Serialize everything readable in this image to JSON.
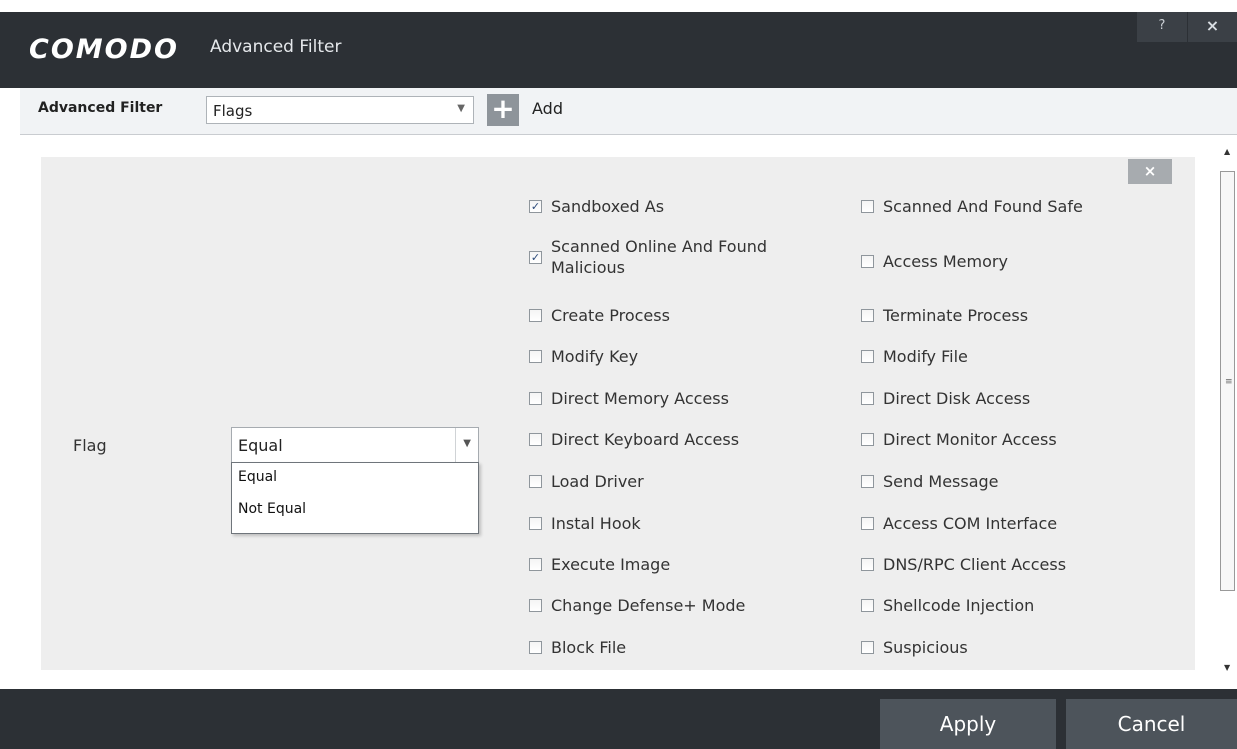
{
  "window": {
    "brand": "COMODO",
    "title": "Advanced Filter",
    "help_label": "?",
    "close_label": "×"
  },
  "toolbar": {
    "filter_label": "Advanced Filter",
    "filter_value": "Flags",
    "add_label": "Add"
  },
  "panel": {
    "remove_label": "×",
    "flag_label": "Flag",
    "condition_value": "Equal",
    "condition_options": [
      "Equal",
      "Not Equal"
    ],
    "flags_left": [
      {
        "label": "Sandboxed As",
        "checked": true
      },
      {
        "label": "Scanned Online And Found Malicious",
        "checked": true
      },
      {
        "label": "Create Process",
        "checked": false
      },
      {
        "label": "Modify Key",
        "checked": false
      },
      {
        "label": "Direct Memory Access",
        "checked": false
      },
      {
        "label": "Direct Keyboard Access",
        "checked": false
      },
      {
        "label": "Load Driver",
        "checked": false
      },
      {
        "label": "Instal Hook",
        "checked": false
      },
      {
        "label": "Execute Image",
        "checked": false
      },
      {
        "label": "Change Defense+ Mode",
        "checked": false
      },
      {
        "label": "Block File",
        "checked": false
      }
    ],
    "flags_right": [
      {
        "label": "Scanned And Found Safe",
        "checked": false
      },
      {
        "label": "Access Memory",
        "checked": false
      },
      {
        "label": "Terminate Process",
        "checked": false
      },
      {
        "label": "Modify File",
        "checked": false
      },
      {
        "label": "Direct Disk Access",
        "checked": false
      },
      {
        "label": "Direct Monitor Access",
        "checked": false
      },
      {
        "label": "Send Message",
        "checked": false
      },
      {
        "label": "Access COM Interface",
        "checked": false
      },
      {
        "label": "DNS/RPC Client Access",
        "checked": false
      },
      {
        "label": "Shellcode Injection",
        "checked": false
      },
      {
        "label": "Suspicious",
        "checked": false
      }
    ]
  },
  "footer": {
    "apply_label": "Apply",
    "cancel_label": "Cancel"
  }
}
